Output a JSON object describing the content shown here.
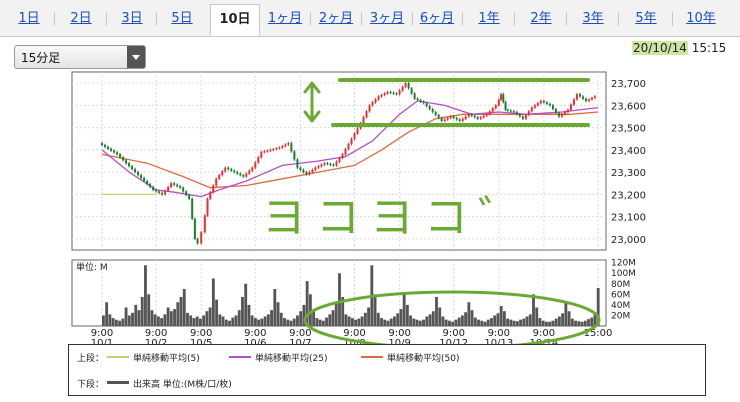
{
  "tabs": [
    "1日",
    "2日",
    "3日",
    "5日",
    "10日",
    "1ヶ月",
    "2ヶ月",
    "3ヶ月",
    "6ヶ月",
    "1年",
    "2年",
    "3年",
    "5年",
    "10年"
  ],
  "active_tab": "10日",
  "interval_select": "15分足",
  "timestamp": {
    "date": "20/10/14",
    "time": "15:15"
  },
  "chart_data": [
    {
      "type": "line",
      "price_axis_ticks": [
        "23,700",
        "23,600",
        "23,500",
        "23,400",
        "23,300",
        "23,200",
        "23,100",
        "23,000"
      ],
      "ylim": [
        22950,
        23750
      ],
      "x_time_labels": [
        "9:00",
        "9:00",
        "9:00",
        "9:00",
        "9:00",
        "9:00",
        "9:00",
        "9:00",
        "9:00",
        "9:00",
        "15:00"
      ],
      "x_date_labels": [
        "10/1",
        "10/2",
        "10/5",
        "10/6",
        "10/7",
        "10/8",
        "10/9",
        "10/12",
        "10/13",
        "10/14",
        ""
      ],
      "price_path": [
        [
          0,
          23430
        ],
        [
          2,
          23380
        ],
        [
          4,
          23300
        ],
        [
          6,
          23220
        ],
        [
          7,
          23200
        ],
        [
          8,
          23250
        ],
        [
          9,
          23230
        ],
        [
          10,
          23180
        ],
        [
          10.6,
          23000
        ],
        [
          11,
          22980
        ],
        [
          11.4,
          23030
        ],
        [
          12,
          23180
        ],
        [
          13,
          23270
        ],
        [
          14,
          23320
        ],
        [
          15,
          23300
        ],
        [
          16,
          23280
        ],
        [
          17,
          23320
        ],
        [
          18,
          23390
        ],
        [
          19,
          23400
        ],
        [
          20,
          23410
        ],
        [
          21,
          23430
        ],
        [
          22,
          23320
        ],
        [
          23,
          23290
        ],
        [
          24,
          23320
        ],
        [
          25,
          23340
        ],
        [
          26,
          23330
        ],
        [
          27,
          23380
        ],
        [
          28,
          23450
        ],
        [
          29,
          23520
        ],
        [
          30,
          23600
        ],
        [
          31,
          23640
        ],
        [
          32,
          23660
        ],
        [
          33,
          23650
        ],
        [
          34,
          23700
        ],
        [
          35,
          23630
        ],
        [
          36,
          23610
        ],
        [
          37,
          23570
        ],
        [
          38,
          23530
        ],
        [
          39,
          23550
        ],
        [
          40,
          23530
        ],
        [
          41,
          23560
        ],
        [
          42,
          23540
        ],
        [
          43,
          23560
        ],
        [
          44,
          23600
        ],
        [
          44.5,
          23650
        ],
        [
          45,
          23580
        ],
        [
          46,
          23570
        ],
        [
          47,
          23540
        ],
        [
          48,
          23590
        ],
        [
          49,
          23620
        ],
        [
          50,
          23600
        ],
        [
          51,
          23550
        ],
        [
          52,
          23580
        ],
        [
          53,
          23650
        ],
        [
          54,
          23620
        ],
        [
          55,
          23640
        ]
      ],
      "sma5_path": [
        [
          0,
          23200
        ],
        [
          4,
          23200
        ],
        [
          6,
          23200
        ]
      ],
      "sma25_path": [
        [
          0,
          23400
        ],
        [
          3,
          23300
        ],
        [
          6,
          23220
        ],
        [
          8,
          23210
        ],
        [
          11,
          23190
        ],
        [
          13,
          23220
        ],
        [
          16,
          23260
        ],
        [
          20,
          23330
        ],
        [
          24,
          23350
        ],
        [
          27,
          23370
        ],
        [
          30,
          23440
        ],
        [
          33,
          23560
        ],
        [
          35,
          23620
        ],
        [
          38,
          23600
        ],
        [
          41,
          23560
        ],
        [
          44,
          23570
        ],
        [
          47,
          23560
        ],
        [
          51,
          23570
        ],
        [
          55,
          23590
        ]
      ],
      "sma50_path": [
        [
          0,
          23380
        ],
        [
          5,
          23340
        ],
        [
          9,
          23280
        ],
        [
          12,
          23230
        ],
        [
          16,
          23240
        ],
        [
          20,
          23270
        ],
        [
          24,
          23300
        ],
        [
          28,
          23330
        ],
        [
          31,
          23400
        ],
        [
          34,
          23480
        ],
        [
          37,
          23540
        ],
        [
          40,
          23560
        ],
        [
          44,
          23560
        ],
        [
          48,
          23560
        ],
        [
          52,
          23560
        ],
        [
          55,
          23570
        ]
      ]
    },
    {
      "type": "bar",
      "unit_label": "単位: M",
      "volume_axis_ticks": [
        "120M",
        "100M",
        "80M",
        "60M",
        "40M",
        "20M"
      ],
      "ylim": [
        0,
        125
      ],
      "values": [
        20,
        45,
        22,
        15,
        12,
        10,
        14,
        35,
        20,
        25,
        40,
        30,
        55,
        115,
        60,
        30,
        22,
        18,
        15,
        22,
        35,
        28,
        32,
        45,
        55,
        70,
        25,
        20,
        15,
        18,
        14,
        20,
        28,
        35,
        90,
        50,
        22,
        18,
        12,
        10,
        16,
        20,
        30,
        55,
        80,
        40,
        20,
        15,
        12,
        14,
        18,
        22,
        30,
        70,
        45,
        25,
        15,
        12,
        10,
        14,
        20,
        28,
        40,
        85,
        60,
        28,
        15,
        12,
        10,
        16,
        22,
        30,
        45,
        100,
        55,
        22,
        18,
        15,
        12,
        14,
        18,
        25,
        35,
        115,
        60,
        25,
        15,
        12,
        10,
        14,
        18,
        24,
        32,
        60,
        40,
        20,
        14,
        12,
        10,
        12,
        18,
        22,
        28,
        55,
        35,
        18,
        12,
        10,
        8,
        12,
        16,
        20,
        26,
        45,
        30,
        16,
        12,
        10,
        8,
        12,
        15,
        20,
        24,
        38,
        28,
        14,
        12,
        10,
        9,
        12,
        14,
        18,
        22,
        60,
        35,
        15,
        10,
        8,
        8,
        10,
        14,
        18,
        24,
        44,
        28,
        14,
        10,
        9,
        8,
        10,
        13,
        16,
        22,
        72
      ]
    }
  ],
  "legend": {
    "upper_label": "上段：",
    "lower_label": "下段：",
    "items": [
      {
        "name": "単純移動平均(5)",
        "color": "#c8d06a"
      },
      {
        "name": "単純移動平均(25)",
        "color": "#b34fd1"
      },
      {
        "name": "単純移動平均(50)",
        "color": "#e06a40"
      }
    ],
    "volume_name": "出来高 単位:(M株/口/枚)",
    "volume_color": "#555555"
  },
  "annotations": {
    "handwritten_text": "ヨコヨコ゛"
  },
  "colors": {
    "up_candle": "#ee2c2c",
    "down_candle": "#1a7f2b",
    "price_line": "#333333",
    "annotation": "#6aaa33",
    "tab_link": "#1a4fbf"
  }
}
